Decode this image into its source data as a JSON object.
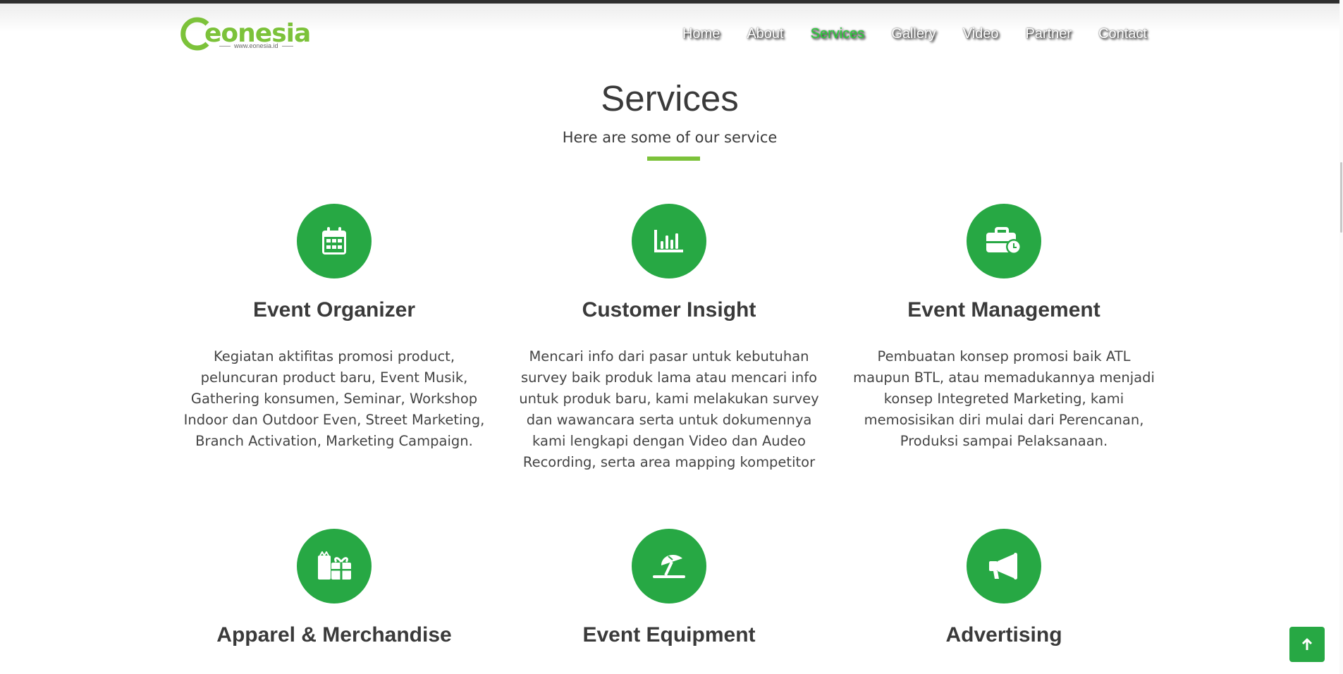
{
  "brand": {
    "name": "eonesia",
    "url": "www.eonesia.id",
    "accent": "#27a844",
    "logo_green": "#7cc23a"
  },
  "nav": {
    "items": [
      {
        "label": "Home"
      },
      {
        "label": "About"
      },
      {
        "label": "Services"
      },
      {
        "label": "Gallery"
      },
      {
        "label": "Video"
      },
      {
        "label": "Partner"
      },
      {
        "label": "Contact"
      }
    ],
    "active": "Services",
    "active_color": "#2ad33a"
  },
  "section": {
    "title": "Services",
    "subtitle": "Here are some of our service"
  },
  "services": [
    {
      "title": "Event Organizer",
      "icon": "calendar-icon",
      "description": "Kegiatan aktifitas promosi product, peluncuran product baru, Event Musik, Gathering konsumen, Seminar, Workshop Indoor dan Outdoor Even, Street Marketing, Branch Activation, Marketing Campaign."
    },
    {
      "title": "Customer Insight",
      "icon": "bar-chart-icon",
      "description": "Mencari info dari pasar untuk kebutuhan survey baik produk lama atau mencari info untuk produk baru, kami melakukan survey dan wawancara serta untuk dokumennya kami lengkapi dengan Video dan Audeo Recording, serta area mapping kompetitor"
    },
    {
      "title": "Event Management",
      "icon": "briefcase-clock-icon",
      "description": "Pembuatan konsep promosi baik ATL maupun BTL, atau memadukannya menjadi konsep Integreted Marketing, kami memosisikan diri mulai dari Perencanan, Produksi sampai Pelaksanaan."
    },
    {
      "title": "Apparel & Merchandise",
      "icon": "gifts-icon",
      "description": ""
    },
    {
      "title": "Event Equipment",
      "icon": "umbrella-beach-icon",
      "description": ""
    },
    {
      "title": "Advertising",
      "icon": "bullhorn-icon",
      "description": ""
    }
  ],
  "scroll_top_icon": "arrow-up-icon"
}
